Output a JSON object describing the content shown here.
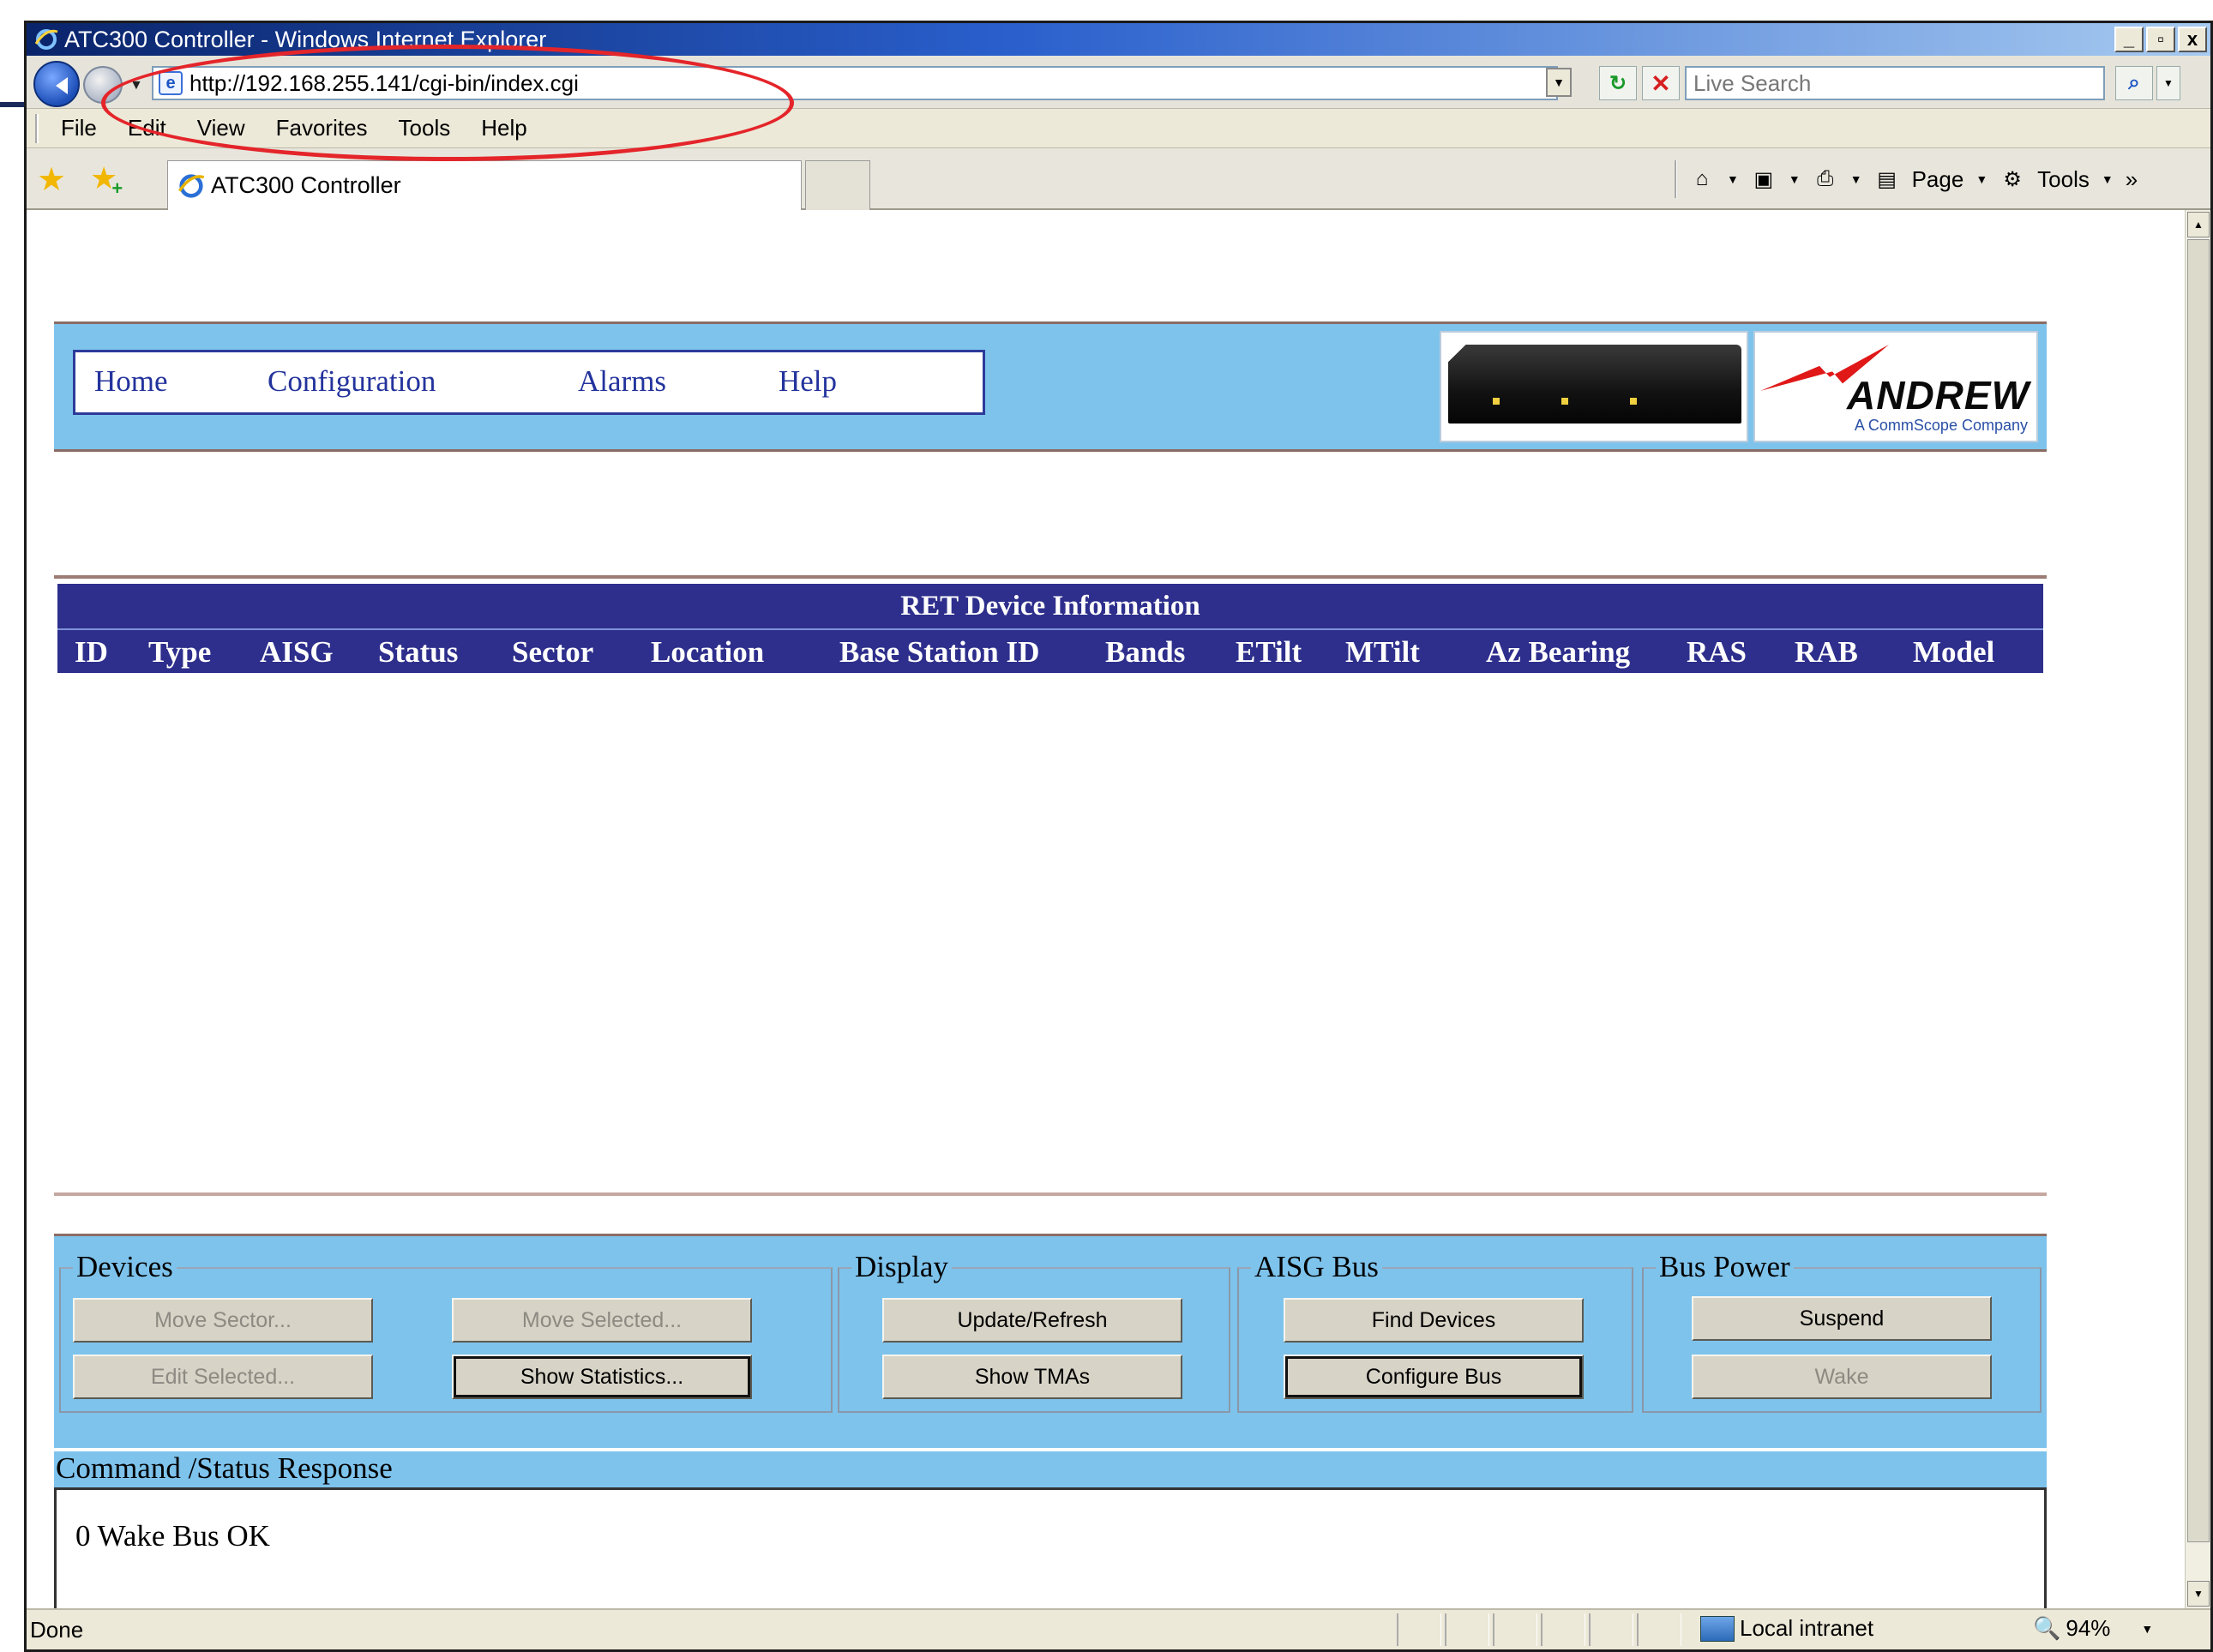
{
  "window": {
    "title": "ATC300 Controller - Windows Internet Explorer",
    "controls": {
      "minimize": "_",
      "maximize": "▫",
      "close": "x"
    }
  },
  "address_bar": {
    "url": "http://192.168.255.141/cgi-bin/index.cgi",
    "search_placeholder": "Live Search"
  },
  "menu": [
    "File",
    "Edit",
    "View",
    "Favorites",
    "Tools",
    "Help"
  ],
  "tabs": {
    "active_title": "ATC300 Controller"
  },
  "command_bar": {
    "page_label": "Page",
    "tools_label": "Tools",
    "overflow": "»"
  },
  "app": {
    "nav": [
      {
        "label": "Home"
      },
      {
        "label": "Configuration"
      },
      {
        "label": "Alarms"
      },
      {
        "label": "Help"
      }
    ],
    "logo": {
      "brand": "ANDREW",
      "sub": "A CommScope Company"
    },
    "table": {
      "title": "RET Device Information",
      "headers": [
        "ID",
        "Type",
        "AISG",
        "Status",
        "Sector",
        "Location",
        "Base Station ID",
        "Bands",
        "ETilt",
        "MTilt",
        "Az Bearing",
        "RAS",
        "RAB",
        "Model"
      ]
    },
    "groups": {
      "devices": {
        "legend": "Devices",
        "move_sector": "Move Sector...",
        "move_selected": "Move Selected...",
        "edit_selected": "Edit Selected...",
        "show_statistics": "Show Statistics..."
      },
      "display": {
        "legend": "Display",
        "update_refresh": "Update/Refresh",
        "show_tmas": "Show TMAs"
      },
      "aisg_bus": {
        "legend": "AISG Bus",
        "find_devices": "Find Devices",
        "configure_bus": "Configure Bus"
      },
      "bus_power": {
        "legend": "Bus Power",
        "suspend": "Suspend",
        "wake": "Wake"
      }
    },
    "status": {
      "label": "Command /Status Response",
      "text": "0 Wake Bus OK"
    }
  },
  "status_bar": {
    "left": "Done",
    "zone": "Local intranet",
    "zoom": "94%"
  },
  "colors": {
    "panel_blue": "#7ec3ec",
    "table_header_navy": "#2e2f8c",
    "nav_link_blue": "#23339c",
    "annotation_red": "#e4252a"
  }
}
